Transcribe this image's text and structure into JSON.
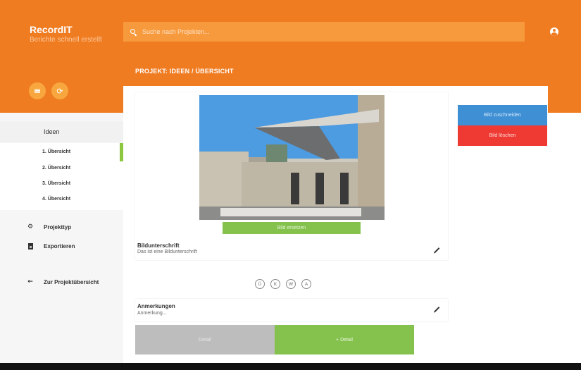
{
  "app": {
    "name": "RecordIT",
    "tagline": "Berichte schnell erstellt"
  },
  "search": {
    "placeholder": "Suche nach Projekten..."
  },
  "header": {
    "breadcrumb": "PROJEKT: IDEEN / ÜBERSICHT"
  },
  "sidebar": {
    "section_title": "Ideen",
    "sub_items": [
      "1. Übersicht",
      "2. Übersicht",
      "3. Übersicht",
      "4. Übersicht"
    ],
    "active_index": 0,
    "nav": [
      {
        "label": "Projekttyp",
        "icon": "gear-icon"
      },
      {
        "label": "Exportieren",
        "icon": "document-icon"
      }
    ],
    "back_label": "Zur Projektübersicht"
  },
  "image_card": {
    "replace_label": "Bild ersetzen",
    "caption_label": "Bildunterschrift",
    "caption_value": "Das ist eine Bildunterschrift"
  },
  "badges": [
    "Ü",
    "K",
    "W",
    "A"
  ],
  "notes": {
    "label": "Anmerkungen",
    "placeholder": "Anmerkung..."
  },
  "detail_buttons": {
    "left_label": "Detail",
    "right_label": "+ Detail"
  },
  "actions": {
    "crop_label": "Bild zuschneiden",
    "delete_label": "Bild löschen"
  },
  "colors": {
    "primary": "#f07c22",
    "search_bg": "#f79a3d",
    "green": "#84c24d",
    "blue": "#3f8fd4",
    "red": "#ee3a33"
  }
}
